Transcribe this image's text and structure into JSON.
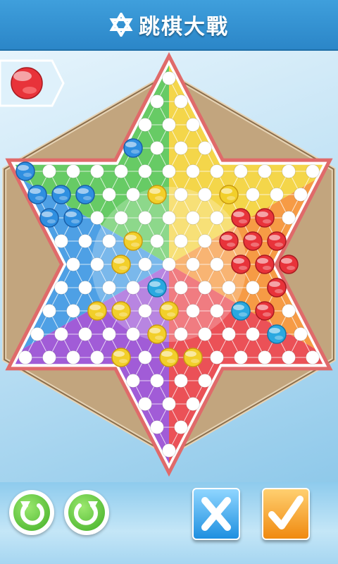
{
  "header": {
    "title": "跳棋大戰",
    "logo_icon": "star-of-david-icon"
  },
  "current_player": {
    "color": "#e8333a",
    "icon": "red-marble-icon"
  },
  "colors": {
    "red": "#e8333a",
    "blue": "#2f8fe0",
    "yellow": "#f2cf2a",
    "green": "#4cc24a",
    "purple": "#9040d0",
    "orange": "#f58a24"
  },
  "board": {
    "marbles": {
      "blue": [
        [
          -4,
          -4
        ],
        [
          -3,
          -4
        ],
        [
          -2,
          -4
        ],
        [
          -3,
          -3
        ],
        [
          -2,
          -3
        ],
        [
          -3,
          -2
        ],
        [
          -5,
          1
        ]
      ],
      "yellow": [
        [
          2,
          -4
        ],
        [
          2,
          -3
        ],
        [
          4,
          -4
        ],
        [
          0,
          -2
        ],
        [
          3,
          -2
        ],
        [
          4,
          -2
        ],
        [
          2,
          -1
        ],
        [
          4,
          -1
        ],
        [
          -1,
          -1
        ],
        [
          -3,
          1
        ],
        [
          -3,
          4
        ]
      ],
      "red": [
        [
          -1,
          3
        ],
        [
          0,
          3
        ],
        [
          2,
          3
        ],
        [
          -2,
          4
        ],
        [
          -1,
          4
        ],
        [
          0,
          4
        ],
        [
          1,
          4
        ],
        [
          -2,
          5
        ],
        [
          -1,
          5
        ],
        [
          0,
          5
        ],
        [
          1,
          4.0001
        ]
      ],
      "cyan": [
        [
          1,
          -1
        ],
        [
          2,
          2
        ],
        [
          3,
          3
        ]
      ]
    }
  },
  "controls": {
    "undo_icon": "undo-arrow-icon",
    "redo_icon": "redo-arrow-icon",
    "cancel_icon": "x-icon",
    "confirm_icon": "checkmark-icon"
  }
}
